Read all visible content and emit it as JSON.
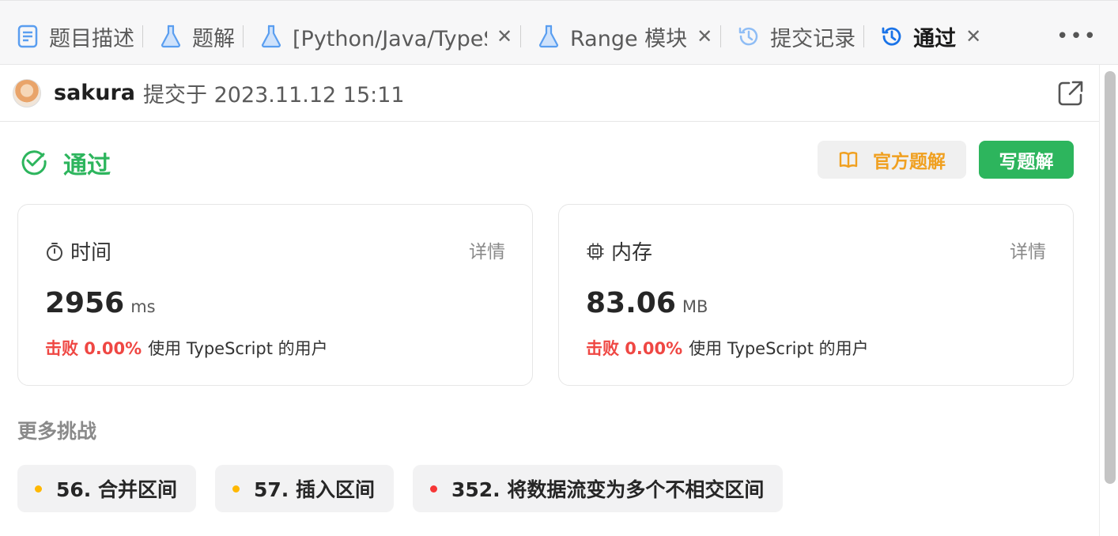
{
  "tabs": [
    {
      "label": "题目描述",
      "icon": "document-icon",
      "closable": false,
      "active": false
    },
    {
      "label": "题解",
      "icon": "flask-icon",
      "closable": false,
      "active": false
    },
    {
      "label": "[Python/Java/TypeScript/Go] 线段树",
      "icon": "flask-icon",
      "closable": true,
      "active": false
    },
    {
      "label": "Range 模块",
      "icon": "flask-icon",
      "closable": true,
      "active": false
    },
    {
      "label": "提交记录",
      "icon": "history-icon",
      "closable": false,
      "active": false
    },
    {
      "label": "通过",
      "icon": "history-icon",
      "closable": true,
      "active": true
    }
  ],
  "tabbar": {
    "more": "•••"
  },
  "submission": {
    "username": "sakura",
    "time_text": "提交于 2023.11.12 15:11"
  },
  "status": {
    "label": "通过",
    "color": "#2db55d"
  },
  "actions": {
    "official_solution": "官方题解",
    "write_solution": "写题解"
  },
  "time_card": {
    "title": "时间",
    "detail": "详情",
    "value": "2956",
    "unit": "ms",
    "beat": "击败 0.00%",
    "beat_tail": "使用 TypeScript 的用户"
  },
  "memory_card": {
    "title": "内存",
    "detail": "详情",
    "value": "83.06",
    "unit": "MB",
    "beat": "击败 0.00%",
    "beat_tail": "使用 TypeScript 的用户"
  },
  "more_challenges": {
    "title": "更多挑战",
    "items": [
      {
        "label": "56. 合并区间",
        "difficulty_color": "#ffb800"
      },
      {
        "label": "57. 插入区间",
        "difficulty_color": "#ffb800"
      },
      {
        "label": "352. 将数据流变为多个不相交区间",
        "difficulty_color": "#f63636"
      }
    ]
  },
  "colors": {
    "accent_green": "#2db55d",
    "danger_red": "#ef4743",
    "official_orange": "#f0a020",
    "tab_active_blue": "#1a73e8"
  }
}
